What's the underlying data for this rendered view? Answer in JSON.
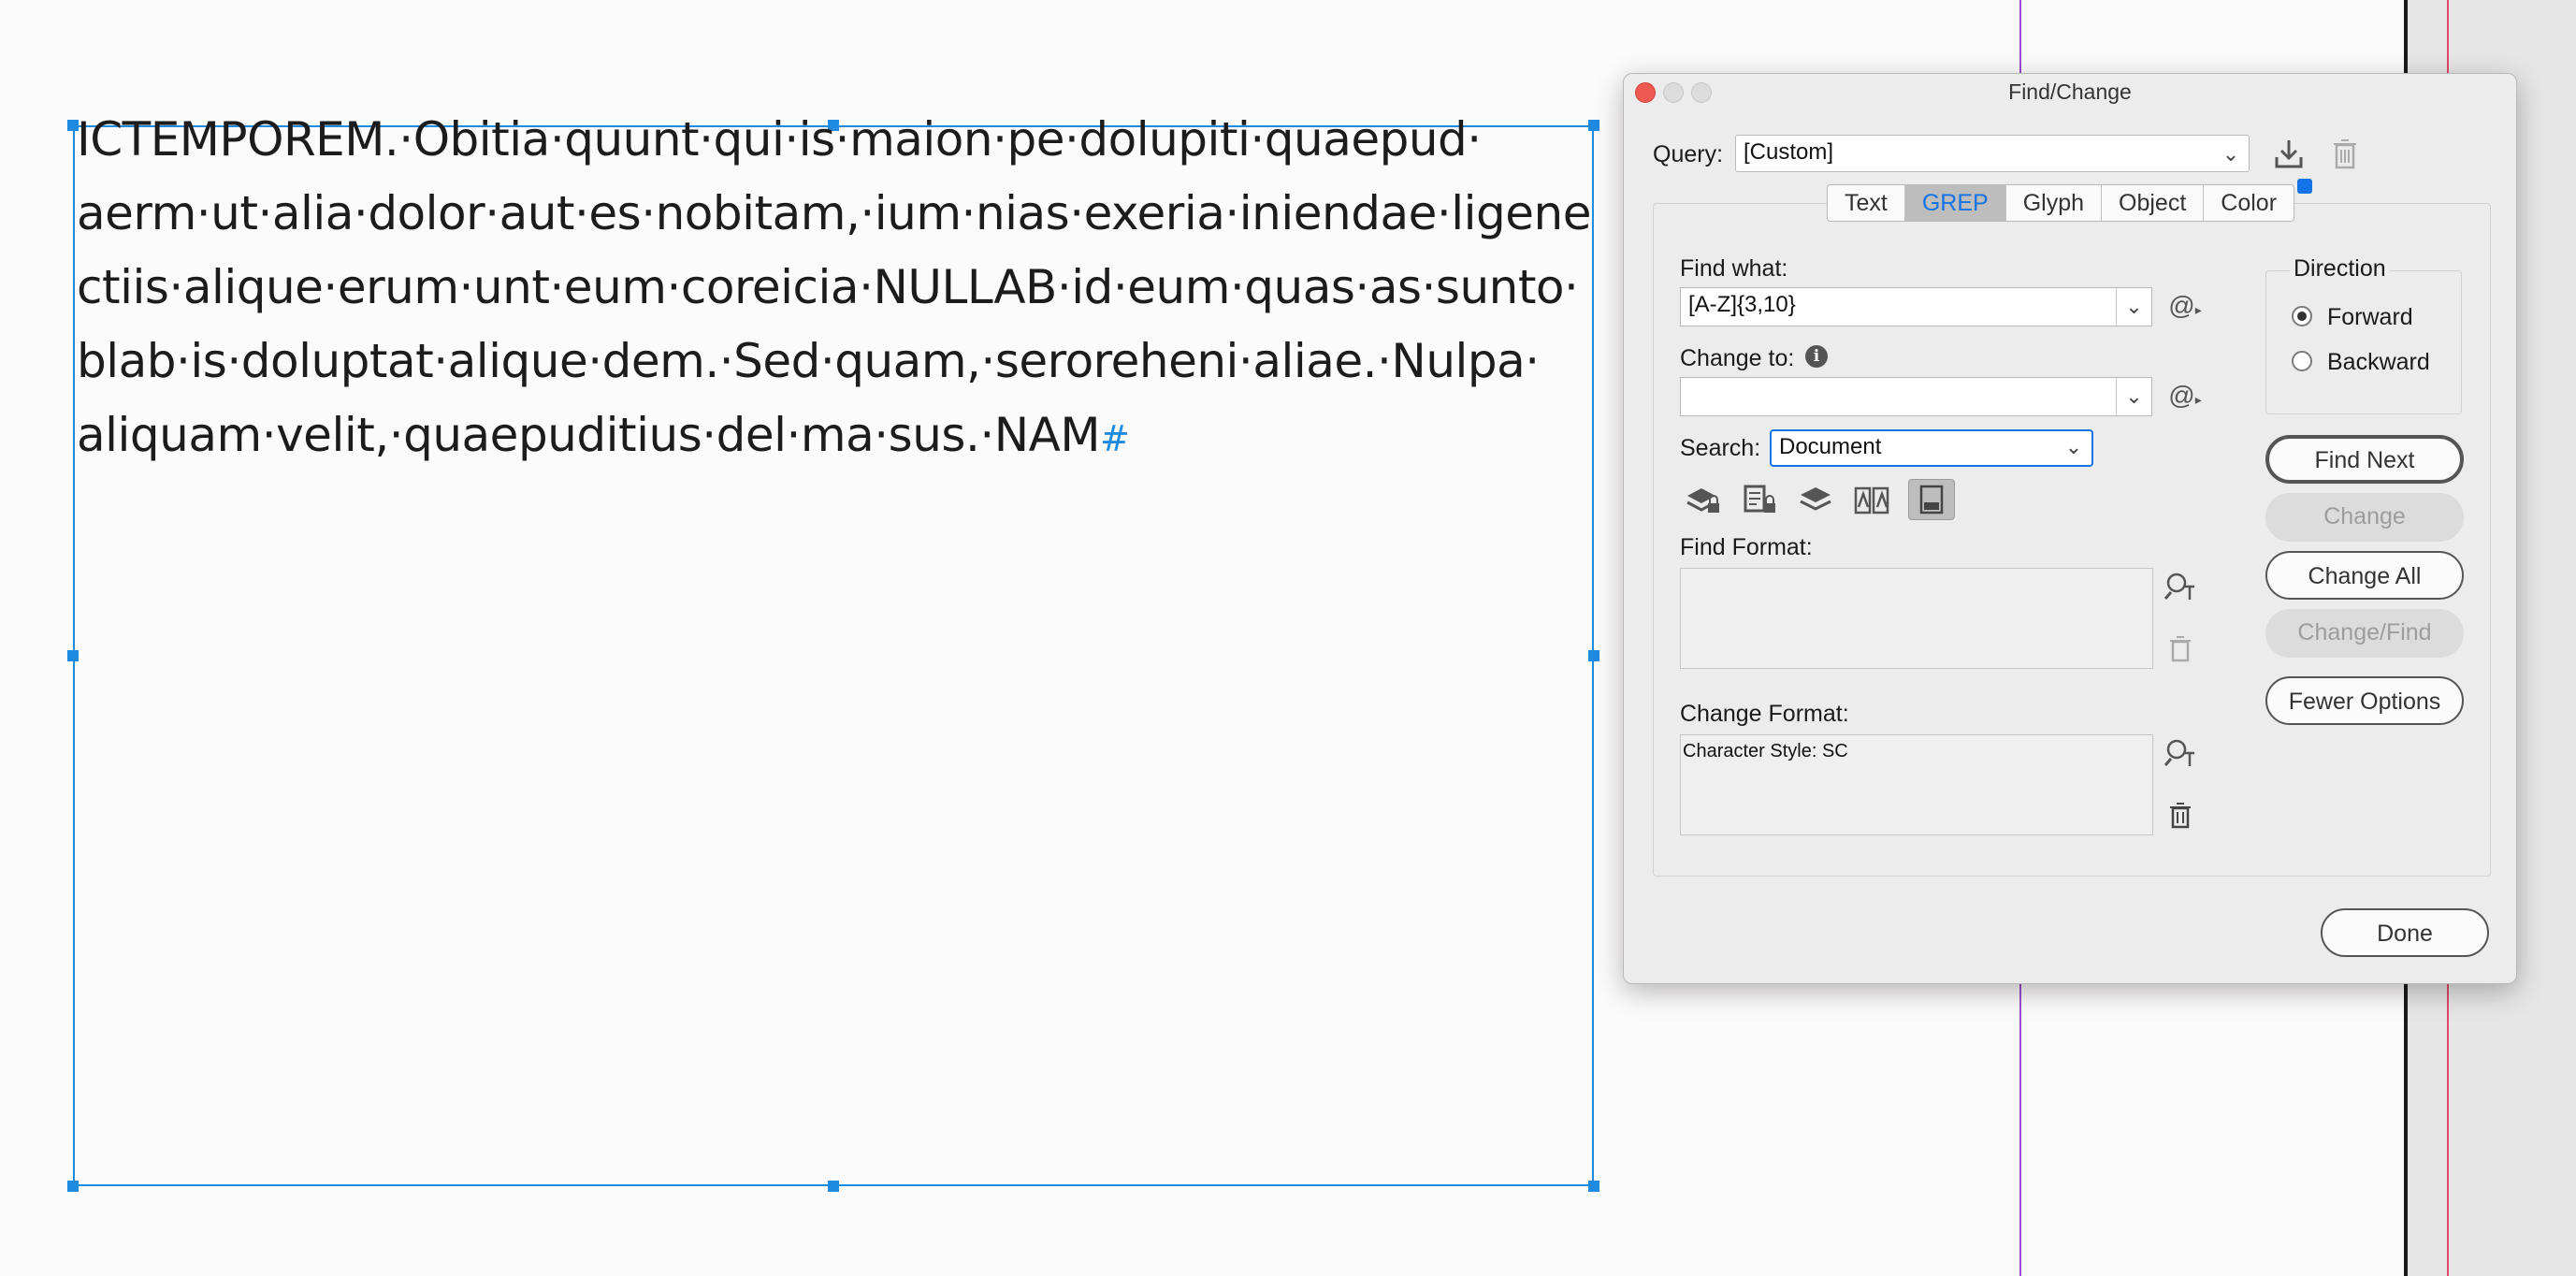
{
  "document": {
    "text_lines": [
      "ICTEMPOREM.·Obitia·quunt·qui·is·maion·pe·dolupiti·quaepud·",
      "aerm·ut·alia·dolor·aut·es·nobitam,·ium·nias·exeria·iniendae·ligene",
      "ctiis·alique·erum·unt·eum·coreicia·NULLAB·id·eum·quas·as·sunto·",
      "blab·is·doluptat·alique·dem.·Sed·quam,·seroreheni·aliae.·Nulpa·",
      "aliquam·velit,·quaepuditius·del·ma·sus.·NAM"
    ],
    "end_mark": "#",
    "colors": {
      "frame": "#1e8ae0",
      "guide_purple": "#9a4fd1",
      "guide_red": "#e0496d"
    }
  },
  "dialog": {
    "title": "Find/Change",
    "query": {
      "label": "Query:",
      "value": "[Custom]",
      "save_icon": "save-query-icon",
      "delete_icon": "trash-icon"
    },
    "tabs": [
      {
        "label": "Text",
        "active": false
      },
      {
        "label": "GREP",
        "active": true
      },
      {
        "label": "Glyph",
        "active": false
      },
      {
        "label": "Object",
        "active": false
      },
      {
        "label": "Color",
        "active": false
      }
    ],
    "find_what": {
      "label": "Find what:",
      "value": "[A-Z]{3,10}",
      "special_icon": "@"
    },
    "change_to": {
      "label": "Change to:",
      "value": "",
      "info_icon": "i",
      "special_icon": "@"
    },
    "search": {
      "label": "Search:",
      "value": "Document"
    },
    "search_option_icons": [
      "locked-layers-icon",
      "locked-stories-icon",
      "hidden-layers-icon",
      "master-pages-icon",
      "footnotes-icon"
    ],
    "find_format": {
      "label": "Find Format:",
      "value": ""
    },
    "change_format": {
      "label": "Change Format:",
      "value": "Character Style: SC"
    },
    "direction": {
      "label": "Direction",
      "options": [
        {
          "label": "Forward",
          "selected": true
        },
        {
          "label": "Backward",
          "selected": false
        }
      ]
    },
    "buttons": {
      "find_next": "Find Next",
      "change": "Change",
      "change_all": "Change All",
      "change_find": "Change/Find",
      "fewer_options": "Fewer Options",
      "done": "Done"
    },
    "accent_color": "#1473e6"
  }
}
